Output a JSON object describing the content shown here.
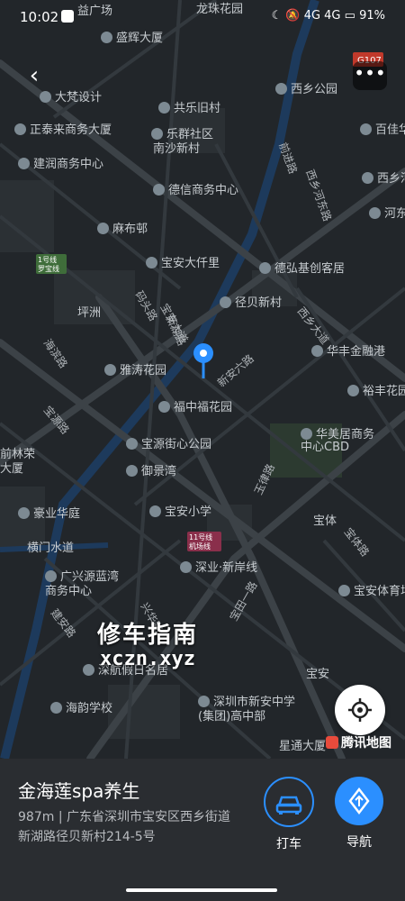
{
  "status_bar": {
    "time": "10:02",
    "network": "4G 4G",
    "battery": "91%"
  },
  "map": {
    "labels": [
      {
        "name": "盛辉大厦",
        "poi": true
      },
      {
        "name": "大梵设计",
        "poi": true
      },
      {
        "name": "共乐旧村",
        "poi": true
      },
      {
        "name": "正泰来商务大厦",
        "poi": true
      },
      {
        "name": "乐群社区",
        "poi": true
      },
      {
        "name": "南沙新村",
        "poi": false
      },
      {
        "name": "建润商务中心",
        "poi": true
      },
      {
        "name": "德信商务中心",
        "poi": true
      },
      {
        "name": "麻布邨",
        "poi": true
      },
      {
        "name": "宝安大仟里",
        "poi": true
      },
      {
        "name": "德弘基创客居",
        "poi": true
      },
      {
        "name": "径贝新村",
        "poi": true
      },
      {
        "name": "坪洲",
        "poi": false
      },
      {
        "name": "华丰金融港",
        "poi": true
      },
      {
        "name": "雅涛花园",
        "poi": true
      },
      {
        "name": "裕丰花园",
        "poi": true
      },
      {
        "name": "福中福花园",
        "poi": true
      },
      {
        "name": "华美居商务",
        "poi": true
      },
      {
        "name": "中心CBD",
        "poi": false
      },
      {
        "name": "宝源街心公园",
        "poi": true
      },
      {
        "name": "御景湾",
        "poi": true
      },
      {
        "name": "豪业华庭",
        "poi": true
      },
      {
        "name": "宝安小学",
        "poi": true
      },
      {
        "name": "宝体",
        "poi": false
      },
      {
        "name": "横门水道",
        "poi": false
      },
      {
        "name": "深业·新岸线",
        "poi": true
      },
      {
        "name": "广兴源蓝湾",
        "poi": true
      },
      {
        "name": "商务中心",
        "poi": false
      },
      {
        "name": "宝安体育场",
        "poi": true
      },
      {
        "name": "深航假日名居",
        "poi": true
      },
      {
        "name": "宝安",
        "poi": false
      },
      {
        "name": "海韵学校",
        "poi": true
      },
      {
        "name": "深圳市新安中学",
        "poi": true
      },
      {
        "name": "(集团)高中部",
        "poi": false
      },
      {
        "name": "星通大厦",
        "poi": false
      },
      {
        "name": "西乡公园",
        "poi": true
      },
      {
        "name": "百佳华商",
        "poi": true
      },
      {
        "name": "西乡河",
        "poi": true
      },
      {
        "name": "河东",
        "poi": true
      },
      {
        "name": "龙珠花园",
        "poi": false
      },
      {
        "name": "益广场",
        "poi": false
      },
      {
        "name": "前林荣",
        "poi": false
      },
      {
        "name": "大厦",
        "poi": false
      }
    ],
    "road_labels": [
      "西乡大道",
      "新安六路",
      "宝源路",
      "宝安大道",
      "码头路",
      "海滨路",
      "建安路",
      "宝体路",
      "宝田一路",
      "玉律路",
      "西乡河东路",
      "前进路",
      "兴华路",
      "新湖路"
    ],
    "badges": [
      "G107",
      "1号线\n罗宝线",
      "11号线\n机场线"
    ],
    "logo_text": "腾讯地图",
    "watermark_line1": "修车指南",
    "watermark_line2": "xczn.xyz"
  },
  "place": {
    "name": "金海莲spa养生",
    "distance": "987m",
    "address_line1": "广东省深圳市宝安区西乡街道",
    "address_line2": "新湖路径贝新村214-5号"
  },
  "actions": {
    "taxi": "打车",
    "navigate": "导航"
  },
  "colors": {
    "accent": "#2b8fff",
    "map_bg": "#22262a",
    "road": "#3c4247",
    "poi_icon": "#7d8a93"
  }
}
